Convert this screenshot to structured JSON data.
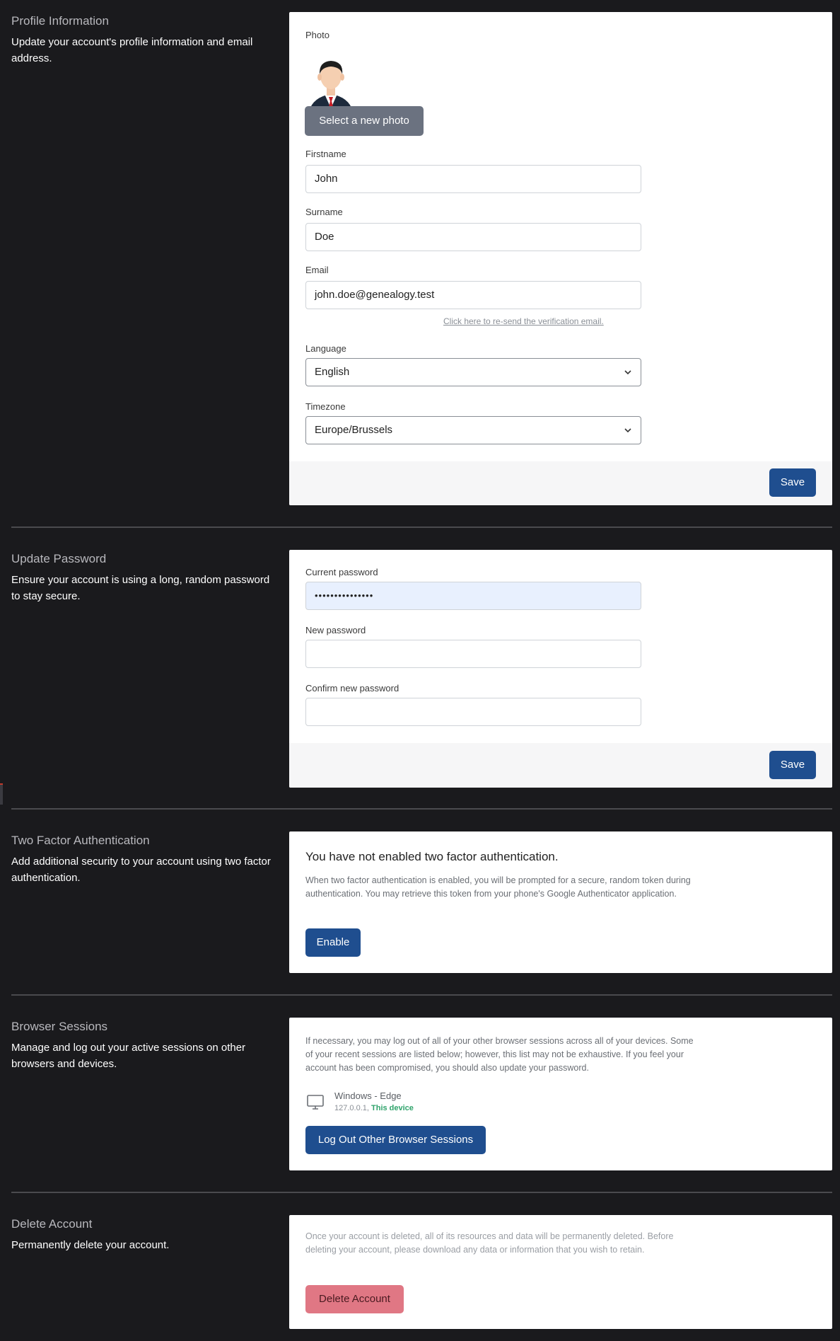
{
  "profile": {
    "title": "Profile Information",
    "description": "Update your account's profile information and email address.",
    "photo_label": "Photo",
    "select_photo_label": "Select a new photo",
    "firstname_label": "Firstname",
    "firstname_value": "John",
    "surname_label": "Surname",
    "surname_value": "Doe",
    "email_label": "Email",
    "email_value": "john.doe@genealogy.test",
    "resend_link": "Click here to re-send the verification email.",
    "language_label": "Language",
    "language_value": "English",
    "timezone_label": "Timezone",
    "timezone_value": "Europe/Brussels",
    "save_label": "Save"
  },
  "password": {
    "title": "Update Password",
    "description": "Ensure your account is using a long, random password to stay secure.",
    "current_label": "Current password",
    "current_value": "•••••••••••••••",
    "new_label": "New password",
    "confirm_label": "Confirm new password",
    "save_label": "Save"
  },
  "two_factor": {
    "title": "Two Factor Authentication",
    "description": "Add additional security to your account using two factor authentication.",
    "status_heading": "You have not enabled two factor authentication.",
    "info": "When two factor authentication is enabled, you will be prompted for a secure, random token during authentication. You may retrieve this token from your phone's Google Authenticator application.",
    "enable_label": "Enable"
  },
  "sessions": {
    "title": "Browser Sessions",
    "description": "Manage and log out your active sessions on other browsers and devices.",
    "info": "If necessary, you may log out of all of your other browser sessions across all of your devices. Some of your recent sessions are listed below; however, this list may not be exhaustive. If you feel your account has been compromised, you should also update your password.",
    "device_name": "Windows - Edge",
    "device_ip": "127.0.0.1,",
    "device_current": "This device",
    "logout_label": "Log Out Other Browser Sessions"
  },
  "delete": {
    "title": "Delete Account",
    "description": "Permanently delete your account.",
    "info": "Once your account is deleted, all of its resources and data will be permanently deleted. Before deleting your account, please download any data or information that you wish to retain.",
    "delete_label": "Delete Account"
  },
  "colors": {
    "background": "#1a1a1d",
    "primary": "#1f4e8f",
    "danger": "#e07784",
    "success": "#2fa36b"
  }
}
